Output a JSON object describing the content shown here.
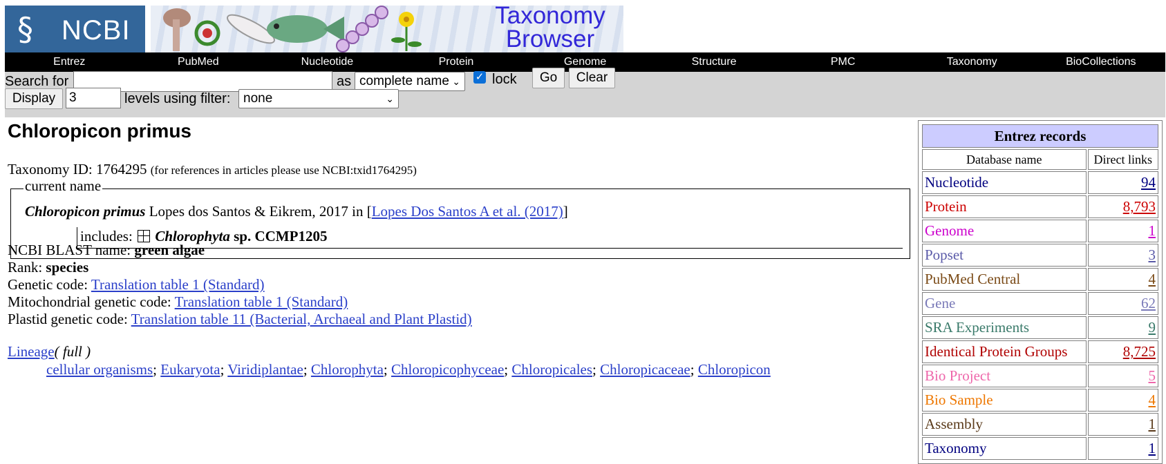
{
  "banner": {
    "ncbi_text": "NCBI",
    "title_line1": "Taxonomy",
    "title_line2": "Browser"
  },
  "nav": [
    "Entrez",
    "PubMed",
    "Nucleotide",
    "Protein",
    "Genome",
    "Structure",
    "PMC",
    "Taxonomy",
    "BioCollections"
  ],
  "search": {
    "label": "Search for",
    "value": "",
    "as_label": "as",
    "mode": "complete name",
    "lock_label": "lock",
    "lock_checked": true,
    "go_label": "Go",
    "clear_label": "Clear"
  },
  "display": {
    "button_label": "Display",
    "levels": "3",
    "levels_label": "levels using filter:",
    "filter": "none"
  },
  "taxon": {
    "name": "Chloropicon primus",
    "id_label": "Taxonomy ID:",
    "id": "1764295",
    "id_note": "(for references in articles please use NCBI:txid1764295)",
    "current_name_legend": "current name",
    "authority": "Lopes dos Santos & Eikrem, 2017 in",
    "reference_link": "Lopes Dos Santos A et al. (2017)",
    "includes_label": "includes:",
    "includes_genus": "Chlorophyta",
    "includes_rest": "sp. CCMP1205",
    "blast_label": "NCBI BLAST name:",
    "blast_name": "green algae",
    "rank_label": "Rank:",
    "rank": "species",
    "genetic_code_label": "Genetic code:",
    "genetic_code": "Translation table 1 (Standard)",
    "mito_code_label": "Mitochondrial genetic code:",
    "mito_code": "Translation table 1 (Standard)",
    "plastid_code_label": "Plastid genetic code:",
    "plastid_code": "Translation table 11 (Bacterial, Archaeal and Plant Plastid)",
    "lineage_label": "Lineage",
    "lineage_full": "( full )",
    "lineage": [
      "cellular organisms",
      "Eukaryota",
      "Viridiplantae",
      "Chlorophyta",
      "Chloropicophyceae",
      "Chloropicales",
      "Chloropicaceae",
      "Chloropicon"
    ]
  },
  "entrez": {
    "title": "Entrez records",
    "col_db": "Database name",
    "col_links": "Direct links",
    "rows": [
      {
        "name": "Nucleotide",
        "count": "94",
        "color": "#000080"
      },
      {
        "name": "Protein",
        "count": "8,793",
        "color": "#cc0000"
      },
      {
        "name": "Genome",
        "count": "1",
        "color": "#cc00cc"
      },
      {
        "name": "Popset",
        "count": "3",
        "color": "#5a5aa8"
      },
      {
        "name": "PubMed Central",
        "count": "4",
        "color": "#7a4a16"
      },
      {
        "name": "Gene",
        "count": "62",
        "color": "#7a7ab8"
      },
      {
        "name": "SRA Experiments",
        "count": "9",
        "color": "#3a7a6a"
      },
      {
        "name": "Identical Protein Groups",
        "count": "8,725",
        "color": "#b00000"
      },
      {
        "name": "Bio Project",
        "count": "5",
        "color": "#ee66aa"
      },
      {
        "name": "Bio Sample",
        "count": "4",
        "color": "#ee7700"
      },
      {
        "name": "Assembly",
        "count": "1",
        "color": "#5a3a1a"
      },
      {
        "name": "Taxonomy",
        "count": "1",
        "color": "#000080"
      }
    ]
  }
}
